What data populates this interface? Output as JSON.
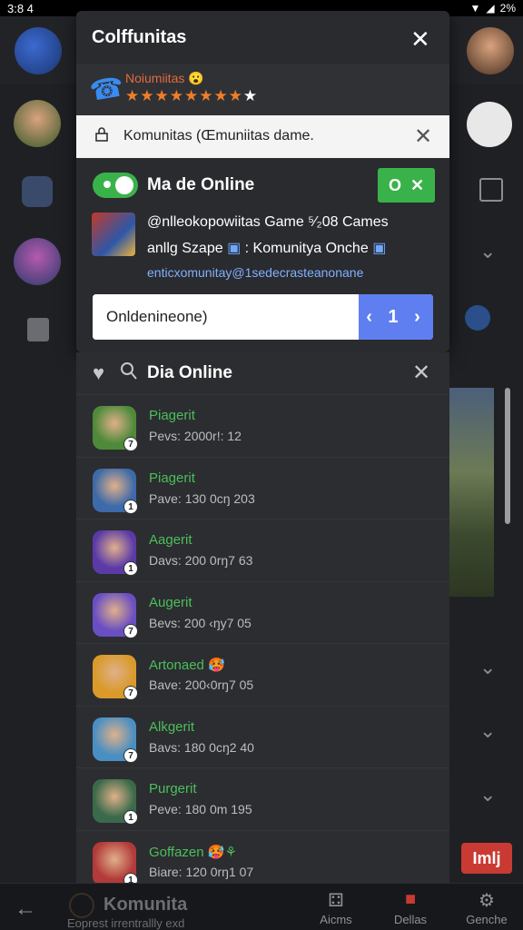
{
  "status_bar": {
    "time": "3:8 4",
    "battery": "2%"
  },
  "modal": {
    "title": "Colffunitas",
    "notification": "Noiumiitas 😮",
    "stars": "★★★★★★★★",
    "star_last": "★"
  },
  "search": {
    "text": "Komunitas (Œmuniitas dame."
  },
  "card": {
    "title": "Ma de Online",
    "chip": "O",
    "description_line1": "@nlleokopowiitas Game ⁵⁄₂08 Cames",
    "description_line2": "anllg Szape",
    "description_line2_blue": "Komunitya Onche",
    "link": "enticxomunitay@1sedecrasteanonane",
    "input_value": "Onldenineone)",
    "input_button": "‹ 1 ›"
  },
  "online_list": {
    "title": "Dia Online",
    "items": [
      {
        "name": "Piagerit",
        "stat": "Pevs: 2000r!: 12",
        "color": "#4e8a3a",
        "badge": "7"
      },
      {
        "name": "Piagerit",
        "stat": "Pave: 130 0cŋ 203",
        "color": "#3d6aa8",
        "badge": "1"
      },
      {
        "name": "Aagerit",
        "stat": "Davs: 200 0rŋ7 63",
        "color": "#5b3aa8",
        "badge": "1"
      },
      {
        "name": "Augerit",
        "stat": "Bevs: 200 ‹ŋy7 05",
        "color": "#6a4fc2",
        "badge": "7"
      },
      {
        "name": "Artonaed 🥵",
        "stat": "Bave: 200‹0rŋ7 05",
        "color": "#d99a2a",
        "badge": "7"
      },
      {
        "name": "Alkgerit",
        "stat": "Bavs: 180 0cŋ2 40",
        "color": "#4a8fc2",
        "badge": "7"
      },
      {
        "name": "Purgerit",
        "stat": "Peve: 180 0m 195",
        "color": "#3a6a4a",
        "badge": "1"
      },
      {
        "name": "Goffazen 🥵⚘",
        "stat": "Biare: 120 0rŋ1 07",
        "color": "#b23a3a",
        "badge": "1"
      }
    ]
  },
  "background": {
    "red_button": "Imlj"
  },
  "bottom_bar": {
    "title": "Komunita",
    "subtitle": "Eoprest irrentrallly exd",
    "tabs": [
      {
        "label": "Aicms",
        "icon": "controller-icon"
      },
      {
        "label": "Dellas",
        "icon": "gift-icon"
      },
      {
        "label": "Genche",
        "icon": "gear-icon"
      }
    ]
  },
  "colors": {
    "accent_green": "#3ab24a",
    "accent_blue": "#5f7ff0",
    "star_orange": "#ef7e2a"
  }
}
